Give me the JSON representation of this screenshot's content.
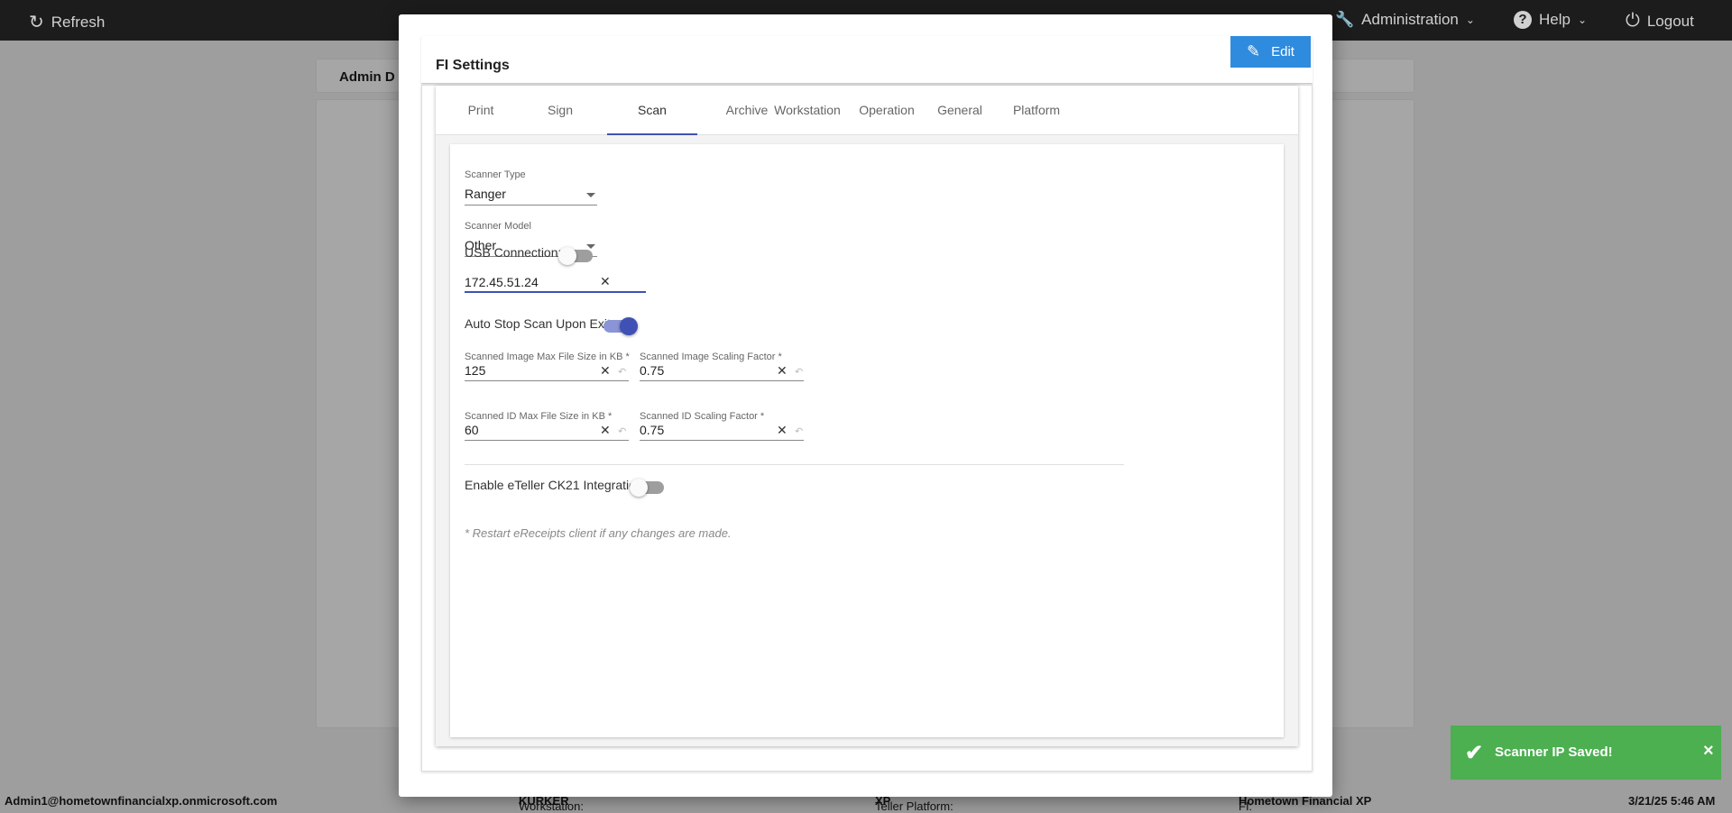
{
  "topbar": {
    "refresh": "Refresh",
    "administration": "Administration",
    "help": "Help",
    "logout": "Logout"
  },
  "background": {
    "card_title": "Admin D"
  },
  "footer": {
    "user": "Admin1@hometownfinancialxp.onmicrosoft.com",
    "workstation_label": "Workstation:",
    "workstation": "KURKER",
    "platform_label": "Teller Platform:",
    "platform": "XP",
    "fi_label": "FI:",
    "fi": "Hometown Financial XP",
    "datetime": "3/21/25 5:46 AM"
  },
  "modal": {
    "title": "FI Settings",
    "edit_label": "Edit",
    "tabs": [
      "Print",
      "Sign",
      "Scan",
      "Archive",
      "Workstation",
      "Operation",
      "General",
      "Platform"
    ],
    "active_tab": "Scan",
    "scanner_type": {
      "label": "Scanner Type",
      "value": "Ranger"
    },
    "scanner_model": {
      "label": "Scanner Model",
      "value": "Other"
    },
    "usb_connection": {
      "label": "USB Connection:",
      "on": false
    },
    "ip": {
      "value": "172.45.51.24"
    },
    "auto_stop": {
      "label": "Auto Stop Scan Upon Exit:",
      "on": true
    },
    "image_max": {
      "label": "Scanned Image Max File Size in KB *",
      "value": "125"
    },
    "image_scale": {
      "label": "Scanned Image Scaling Factor *",
      "value": "0.75"
    },
    "id_max": {
      "label": "Scanned ID Max File Size in KB *",
      "value": "60"
    },
    "id_scale": {
      "label": "Scanned ID Scaling Factor *",
      "value": "0.75"
    },
    "ck21": {
      "label": "Enable eTeller CK21 Integration:",
      "on": false
    },
    "note": "* Restart eReceipts client if any changes are made."
  },
  "toast": {
    "message": "Scanner IP Saved!",
    "close": "×"
  },
  "colors": {
    "accent": "#3f51b5",
    "edit": "#2f8bde",
    "toast": "#4caf50"
  }
}
